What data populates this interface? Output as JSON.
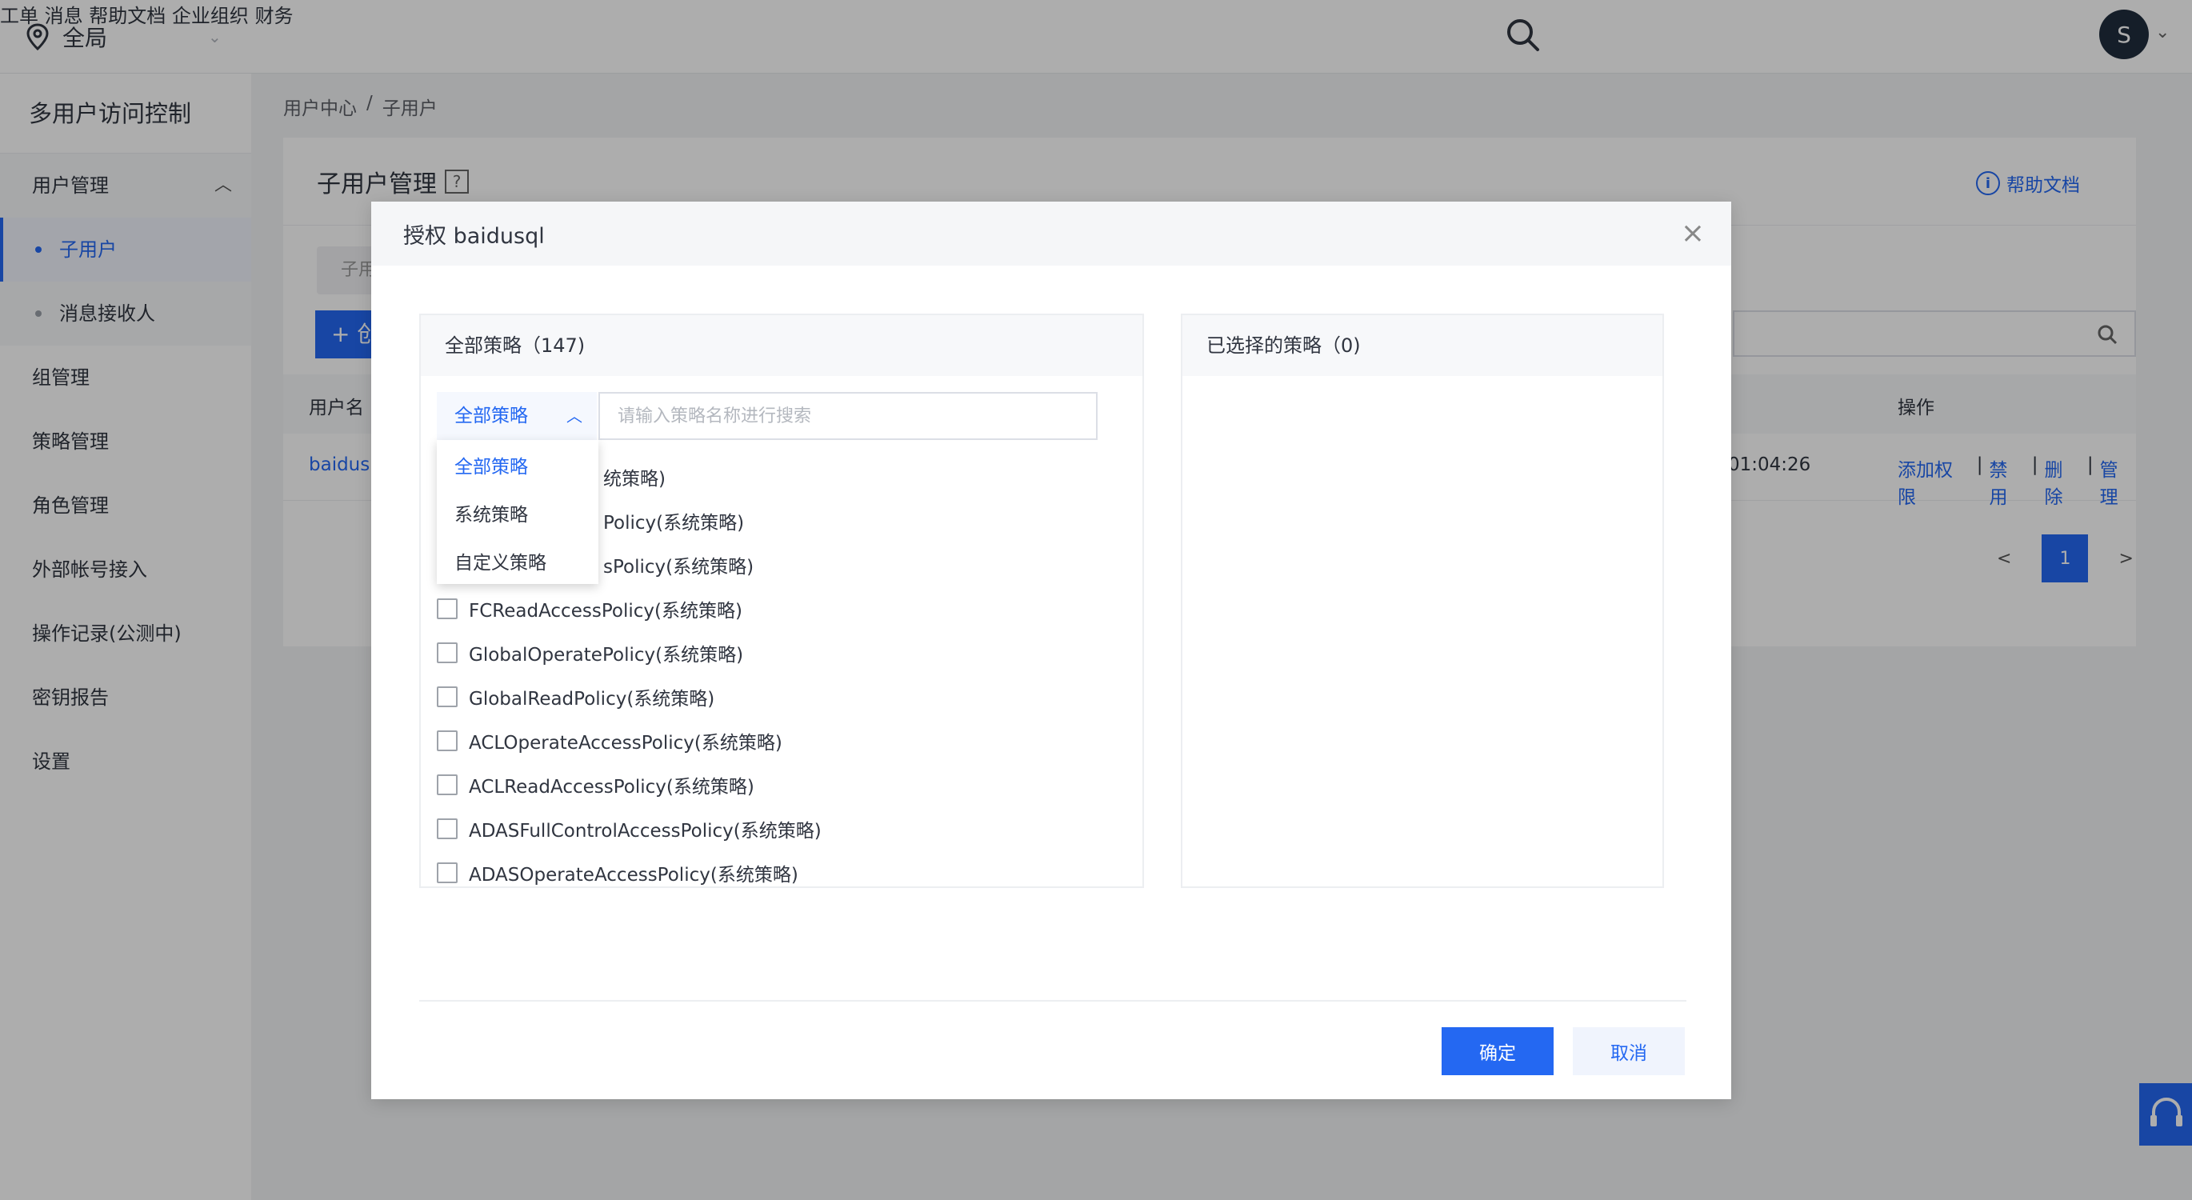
{
  "topbar": {
    "region": "全局",
    "nav": [
      "工单",
      "消息",
      "帮助文档",
      "企业组织",
      "财务"
    ],
    "avatar_letter": "S"
  },
  "sidebar": {
    "title": "多用户访问控制",
    "group": "用户管理",
    "sub_items": [
      "子用户",
      "消息接收人"
    ],
    "items": [
      "组管理",
      "策略管理",
      "角色管理",
      "外部帐号接入",
      "操作记录(公测中)",
      "密钥报告",
      "设置"
    ]
  },
  "breadcrumb": [
    "用户中心",
    "/",
    "子用户"
  ],
  "card": {
    "title": "子用户管理",
    "qmark": "?",
    "help_link": "帮助文档",
    "tab_text": "子用",
    "create_text": "+ 创",
    "col_user": "用户名",
    "col_ops": "操作",
    "row": {
      "name": "baidus",
      "time": "01:04:26",
      "ops": [
        "添加权限",
        "禁用",
        "删除",
        "管理"
      ],
      "sep": "|"
    },
    "pager": {
      "prev": "<",
      "page": "1",
      "next": ">"
    }
  },
  "modal": {
    "title": "授权 baidusql",
    "close": "×",
    "left_title": "全部策略（147)",
    "right_title": "已选择的策略（0)",
    "type_selected": "全部策略",
    "search_placeholder": "请输入策略名称进行搜索",
    "dropdown": [
      "全部策略",
      "系统策略",
      "自定义策略"
    ],
    "policies": [
      "统策略)",
      "Policy(系统策略)",
      "sPolicy(系统策略)",
      "FCReadAccessPolicy(系统策略)",
      "GlobalOperatePolicy(系统策略)",
      "GlobalReadPolicy(系统策略)",
      "ACLOperateAccessPolicy(系统策略)",
      "ACLReadAccessPolicy(系统策略)",
      "ADASFullControlAccessPolicy(系统策略)",
      "ADASOperateAccessPolicy(系统策略)"
    ],
    "ok": "确定",
    "cancel": "取消"
  }
}
